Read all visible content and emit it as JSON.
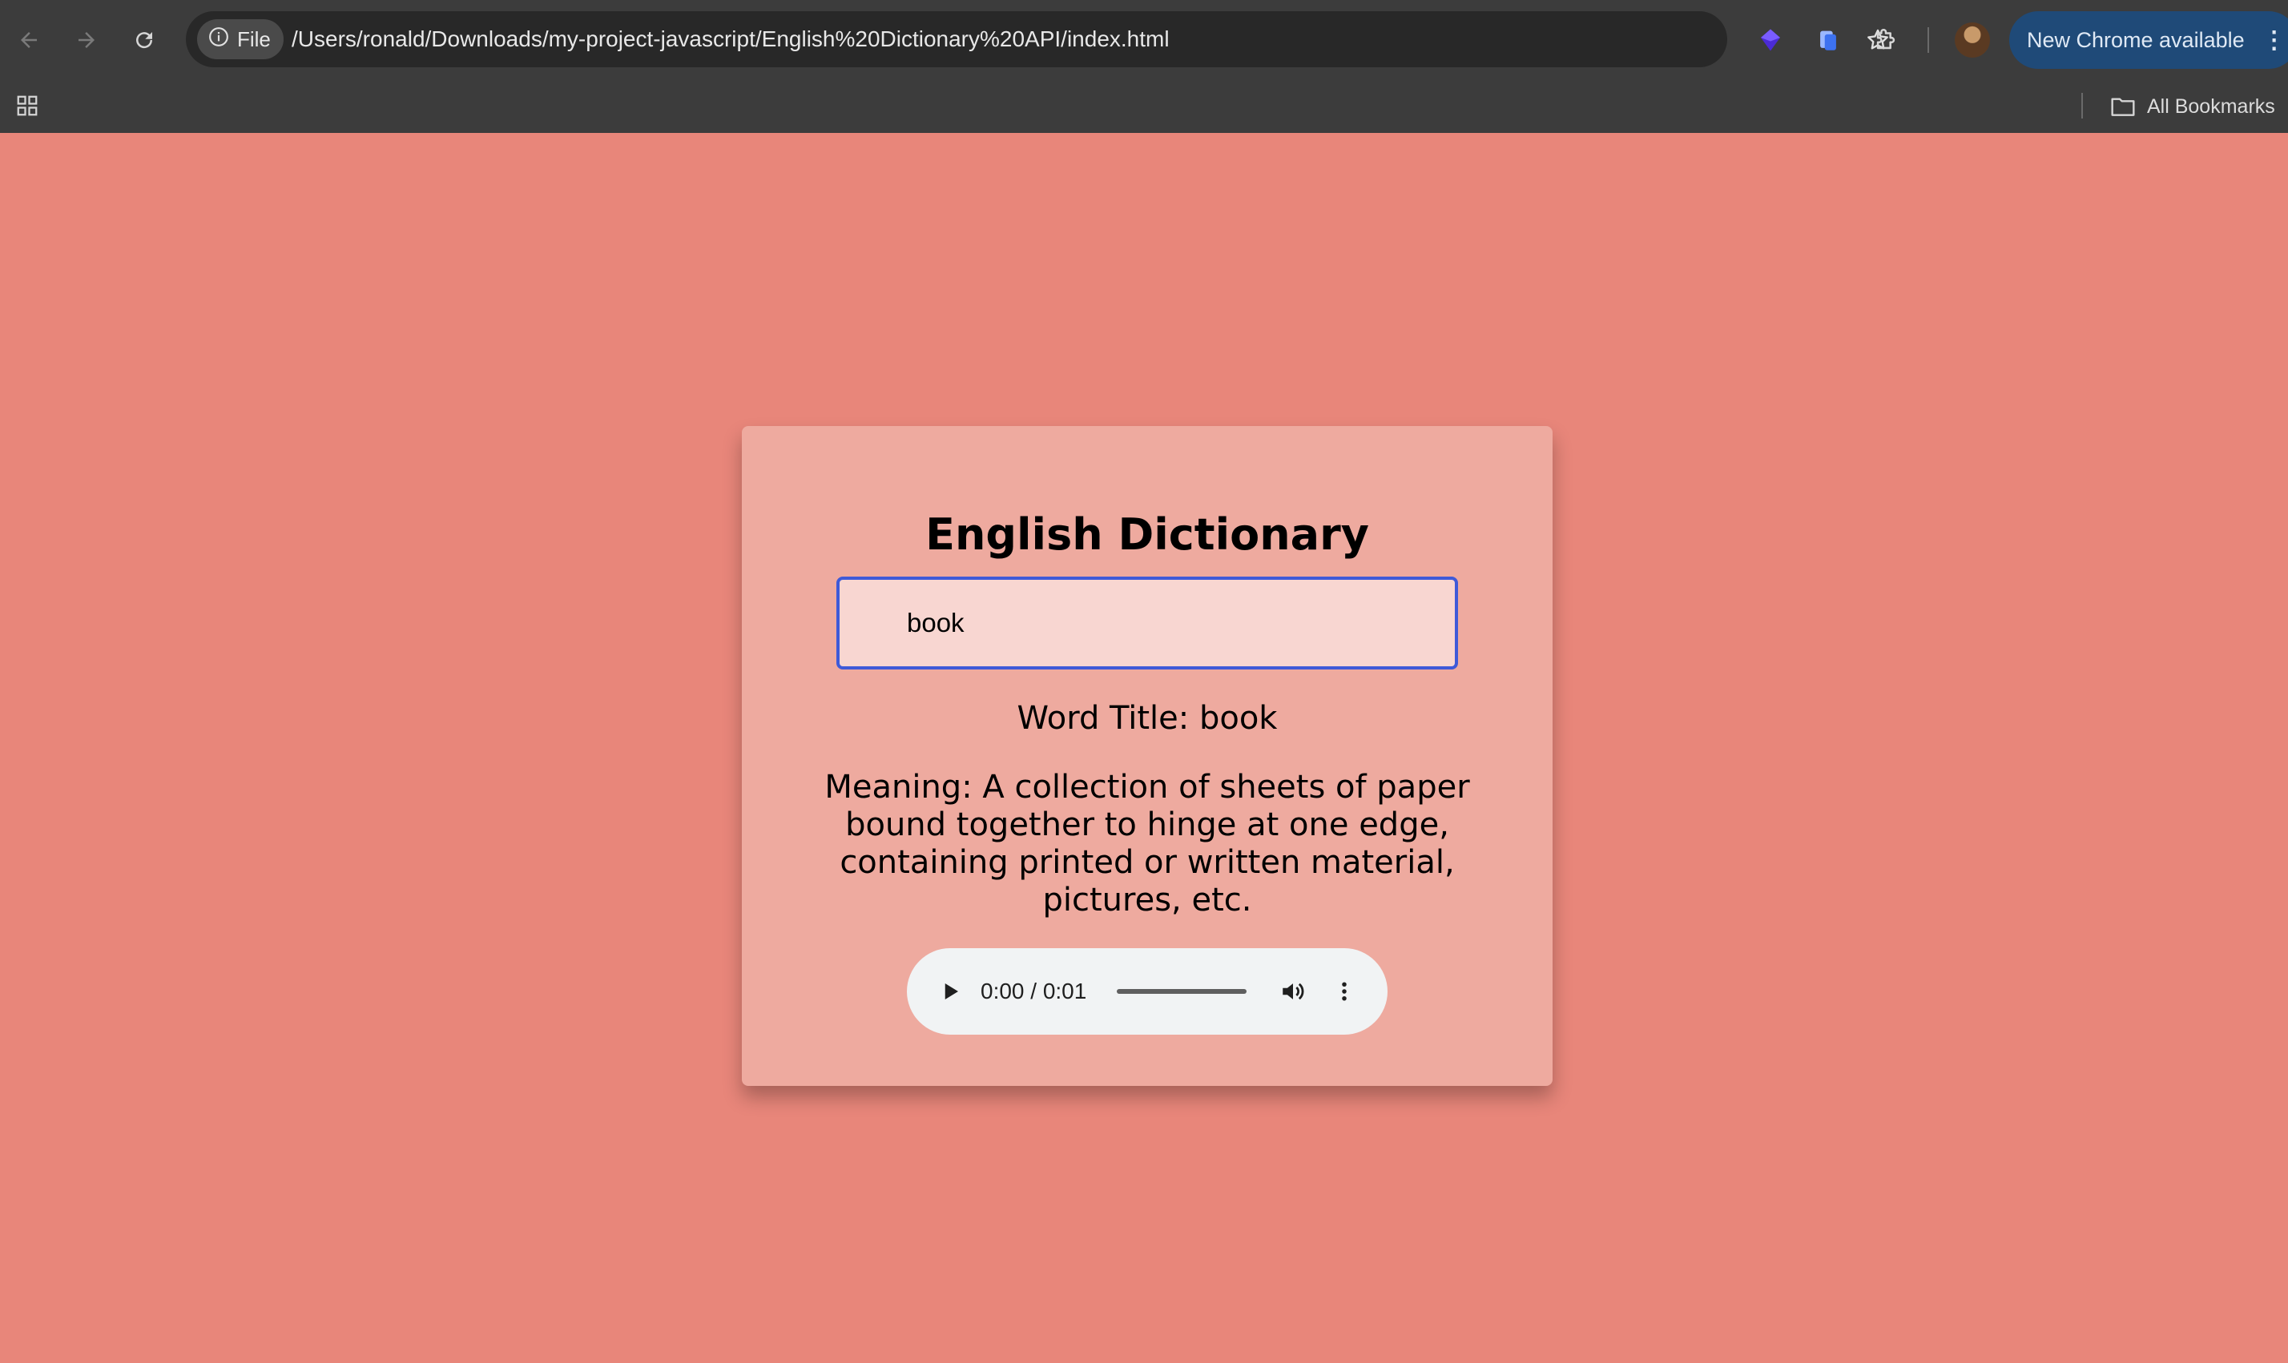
{
  "browser": {
    "site_chip_label": "File",
    "url": "/Users/ronald/Downloads/my-project-javascript/English%20Dictionary%20API/index.html",
    "update_button_label": "New Chrome available",
    "all_bookmarks_label": "All Bookmarks",
    "icons": [
      "back-icon",
      "forward-icon",
      "reload-icon",
      "info-icon",
      "star-icon",
      "extension-purple-icon",
      "extension-clipboard-icon",
      "puzzle-icon",
      "more-vert-icon",
      "apps-icon",
      "folder-icon"
    ],
    "colors": {
      "toolbar": "#3c3c3c",
      "omnibox": "#282828",
      "update_button": "#1f4a78"
    }
  },
  "app": {
    "title": "English Dictionary",
    "search_value": "book",
    "word_title": "Word Title: book",
    "meaning": "Meaning: A collection of sheets of paper bound together to hinge at one edge, containing printed or written material, pictures, etc.",
    "audio": {
      "time": "0:00 / 0:01",
      "progress": 0.0,
      "icons": [
        "play-icon",
        "volume-icon",
        "more-vert-icon"
      ]
    },
    "colors": {
      "background": "#e8867a",
      "card": "#eeaa9f",
      "input_background": "#f8d6d1",
      "input_border": "#3f5ad8"
    }
  }
}
